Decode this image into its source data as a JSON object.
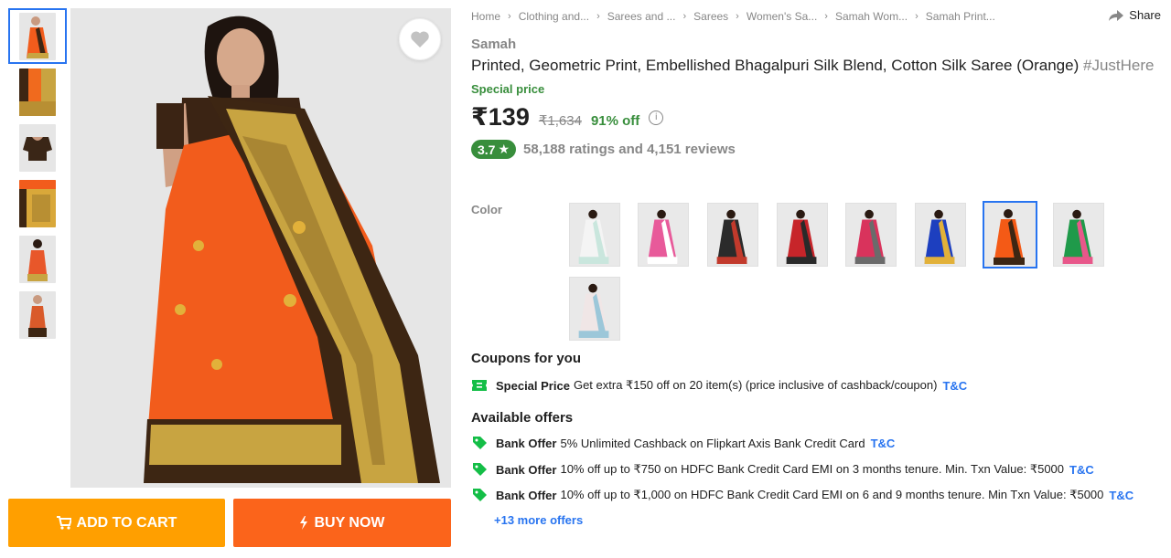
{
  "breadcrumb": [
    "Home",
    "Clothing and...",
    "Sarees and ...",
    "Sarees",
    "Women's Sa...",
    "Samah Wom...",
    "Samah Print..."
  ],
  "share_label": "Share",
  "brand": "Samah",
  "title": "Printed, Geometric Print, Embellished Bhagalpuri Silk Blend, Cotton Silk Saree  (Orange)",
  "title_tag": "#JustHere",
  "special_price_label": "Special price",
  "price": "₹139",
  "mrp": "₹1,634",
  "discount": "91% off",
  "info_icon": "i",
  "rating": "3.7",
  "rating_star": "★",
  "ratings_reviews": "58,188 ratings and 4,151 reviews",
  "color_label": "Color",
  "color_swatches": [
    {
      "name": "white",
      "accent": "#f4f4f4",
      "border": "#c9e6dd"
    },
    {
      "name": "pink-white",
      "accent": "#e85a9a",
      "border": "#ffffff"
    },
    {
      "name": "black-red",
      "accent": "#2b2b2b",
      "border": "#c23a2c"
    },
    {
      "name": "red-black",
      "accent": "#c7252a",
      "border": "#2a2a2a"
    },
    {
      "name": "pink-grey",
      "accent": "#d9335c",
      "border": "#6b6b6b"
    },
    {
      "name": "blue",
      "accent": "#1d3fbf",
      "border": "#e2b13a"
    },
    {
      "name": "orange",
      "accent": "#f45a16",
      "border": "#3d2613"
    },
    {
      "name": "green-pink",
      "accent": "#1f9a4a",
      "border": "#e8578a"
    },
    {
      "name": "light-blue",
      "accent": "#f0e6e6",
      "border": "#9cc7d9"
    }
  ],
  "thumbnails": [
    {
      "icon": "saree-model",
      "color": "#f25c1c"
    },
    {
      "icon": "saree-fabric",
      "color": "#f06a1e"
    },
    {
      "icon": "blouse",
      "color": "#3a2617"
    },
    {
      "icon": "fabric-detail",
      "color": "#d9a83a"
    },
    {
      "icon": "saree-model-back",
      "color": "#e8572a"
    },
    {
      "icon": "saree-model-side",
      "color": "#d95a2a"
    }
  ],
  "coupons_title": "Coupons for you",
  "coupon": {
    "label": "Special Price",
    "text": "Get extra ₹150 off on 20 item(s) (price inclusive of cashback/coupon)",
    "tnc": "T&C"
  },
  "offers_title": "Available offers",
  "offers": [
    {
      "label": "Bank Offer",
      "text": "5% Unlimited Cashback on Flipkart Axis Bank Credit Card",
      "tnc": "T&C"
    },
    {
      "label": "Bank Offer",
      "text": "10% off up to ₹750 on HDFC Bank Credit Card EMI on 3 months tenure. Min. Txn Value: ₹5000",
      "tnc": "T&C"
    },
    {
      "label": "Bank Offer",
      "text": "10% off up to ₹1,000 on HDFC Bank Credit Card EMI on 6 and 9 months tenure. Min Txn Value: ₹5000",
      "tnc": "T&C"
    }
  ],
  "more_offers": "+13 more offers",
  "add_to_cart": "ADD TO CART",
  "buy_now": "BUY NOW",
  "colors": {
    "accent_blue": "#2874f0",
    "green": "#388e3c",
    "cart_orange": "#ff9f00",
    "buy_orange": "#fb641b",
    "muted": "#878787"
  }
}
